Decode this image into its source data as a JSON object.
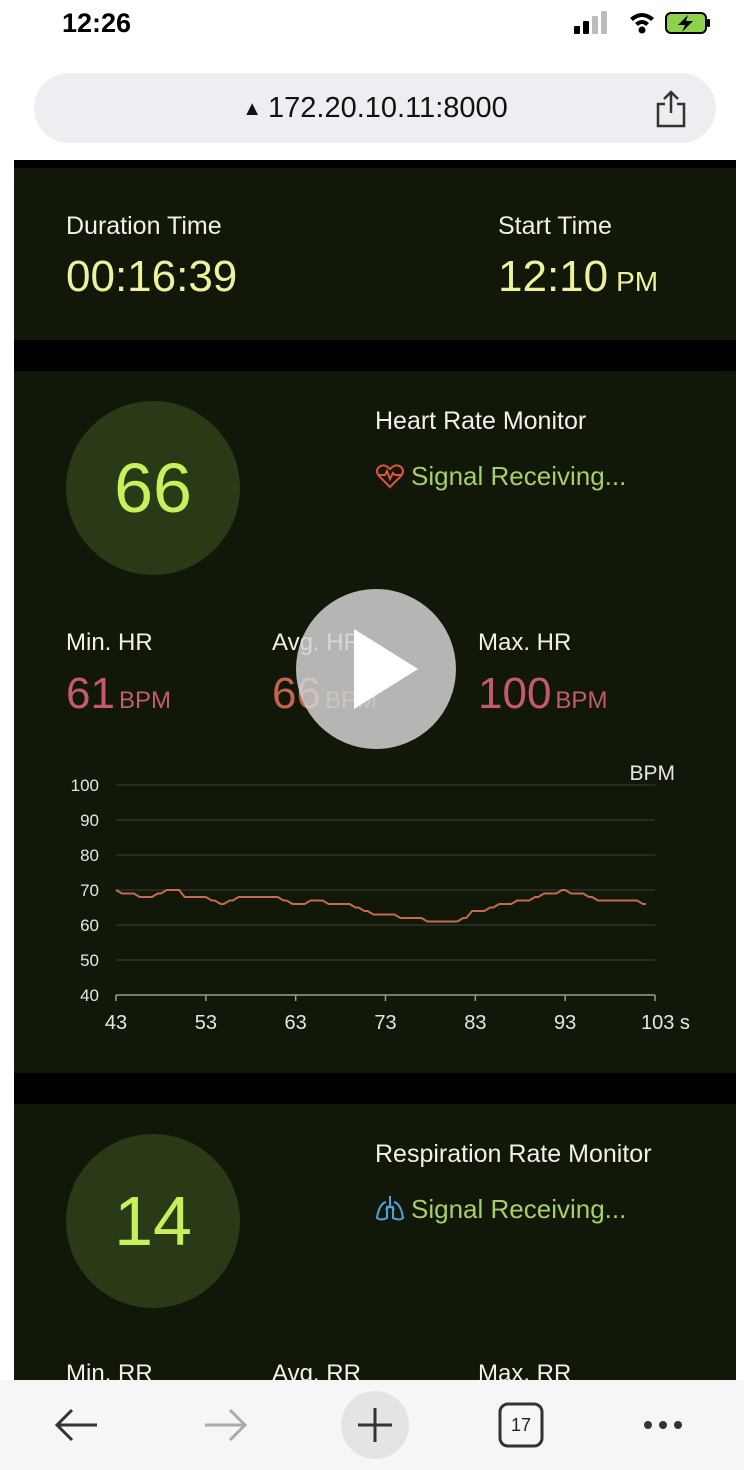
{
  "status": {
    "time": "12:26"
  },
  "browser": {
    "url": "172.20.10.11:8000",
    "tab_count": "17"
  },
  "page": {
    "stray_text": "\">",
    "duration": {
      "label": "Duration Time",
      "value": "00:16:39"
    },
    "start": {
      "label": "Start Time",
      "value": "12:10",
      "suffix": "PM"
    },
    "hr": {
      "value": "66",
      "title": "Heart Rate Monitor",
      "signal": "Signal Receiving...",
      "min_label": "Min. HR",
      "min_value": "61",
      "avg_label": "Avg. HR",
      "avg_value": "66",
      "max_label": "Max. HR",
      "max_value": "100",
      "unit": "BPM"
    },
    "rr": {
      "value": "14",
      "title": "Respiration Rate Monitor",
      "signal": "Signal Receiving...",
      "min_label": "Min. RR",
      "avg_label": "Avg. RR",
      "max_label": "Max. RR"
    }
  },
  "colors": {
    "line": "#c56a4a",
    "grid": "#2e3426",
    "axis_text": "#e6e6e6"
  },
  "chart_data": {
    "type": "line",
    "ylabel": "BPM",
    "xlabel": "",
    "x_tick_labels": [
      "43",
      "53",
      "63",
      "73",
      "83",
      "93",
      "103 s"
    ],
    "y_ticks": [
      40,
      50,
      60,
      70,
      80,
      90,
      100
    ],
    "xlim": [
      43,
      103
    ],
    "ylim": [
      40,
      100
    ],
    "grid": true,
    "series": [
      {
        "x": [
          43,
          44,
          45,
          46,
          47,
          48,
          49,
          50,
          51,
          52,
          53,
          54,
          55,
          56,
          57,
          58,
          59,
          60,
          61,
          62,
          63,
          64,
          65,
          66,
          67,
          68,
          69,
          70,
          71,
          72,
          73,
          74,
          75,
          76,
          77,
          78,
          79,
          80,
          81,
          82,
          83,
          84,
          85,
          86,
          87,
          88,
          89,
          90,
          91,
          92,
          93,
          94,
          95,
          96,
          97,
          98,
          99,
          100,
          101,
          102
        ],
        "y": [
          70,
          69,
          69,
          68,
          68,
          69,
          70,
          70,
          68,
          68,
          68,
          67,
          66,
          67,
          68,
          68,
          68,
          68,
          68,
          67,
          66,
          66,
          67,
          67,
          66,
          66,
          66,
          65,
          64,
          63,
          63,
          63,
          62,
          62,
          62,
          61,
          61,
          61,
          61,
          62,
          64,
          64,
          65,
          66,
          66,
          67,
          67,
          68,
          69,
          69,
          70,
          69,
          69,
          68,
          67,
          67,
          67,
          67,
          67,
          66
        ]
      }
    ]
  }
}
